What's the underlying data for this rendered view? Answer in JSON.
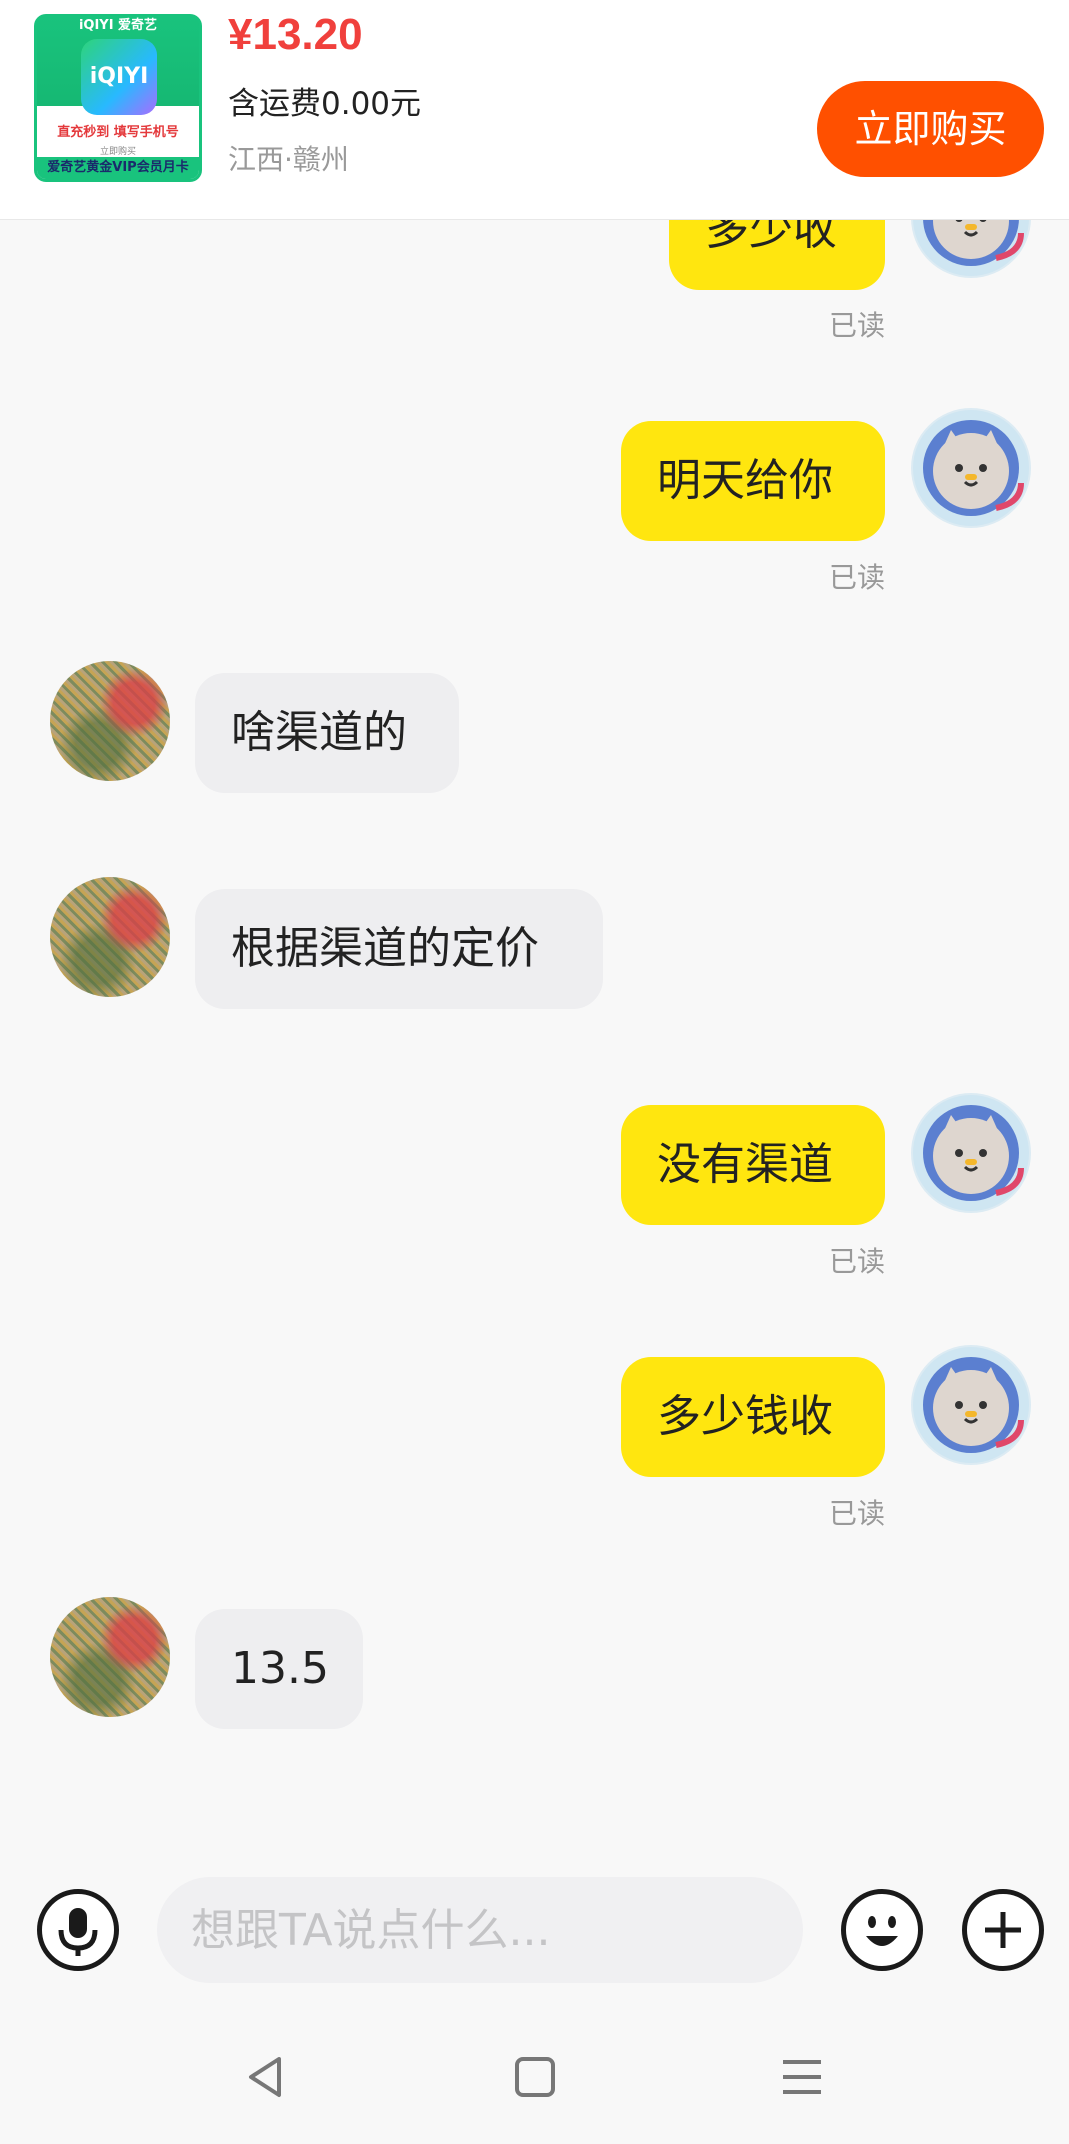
{
  "product": {
    "thumbnail": {
      "top_text": "iQIYI 爱奇艺",
      "logo_text": "iQIYI",
      "line1": "直充秒到 填写手机号",
      "line2": "立即购买",
      "line3": "爱奇艺黄金VIP会员月卡"
    },
    "price": "¥13.20",
    "shipping": "含运费0.00元",
    "location": "江西·赣州",
    "buy_label": "立即购买"
  },
  "messages": [
    {
      "side": "me",
      "text": "多少收",
      "read": "已读"
    },
    {
      "side": "me",
      "text": "明天给你",
      "read": "已读"
    },
    {
      "side": "other",
      "text": "啥渠道的"
    },
    {
      "side": "other",
      "text": "根据渠道的定价"
    },
    {
      "side": "me",
      "text": "没有渠道",
      "read": "已读"
    },
    {
      "side": "me",
      "text": "多少钱收",
      "read": "已读"
    },
    {
      "side": "other",
      "text": "13.5"
    }
  ],
  "input": {
    "placeholder": "想跟TA说点什么..."
  },
  "icons": {
    "voice": "microphone-icon",
    "emoji": "emoji-icon",
    "more": "plus-icon",
    "back": "back-icon",
    "home": "home-icon",
    "menu": "menu-icon"
  },
  "colors": {
    "my_bubble": "#ffe60f",
    "other_bubble": "#eeeef0",
    "buy_button": "#ff5000",
    "price": "#f0403c"
  }
}
